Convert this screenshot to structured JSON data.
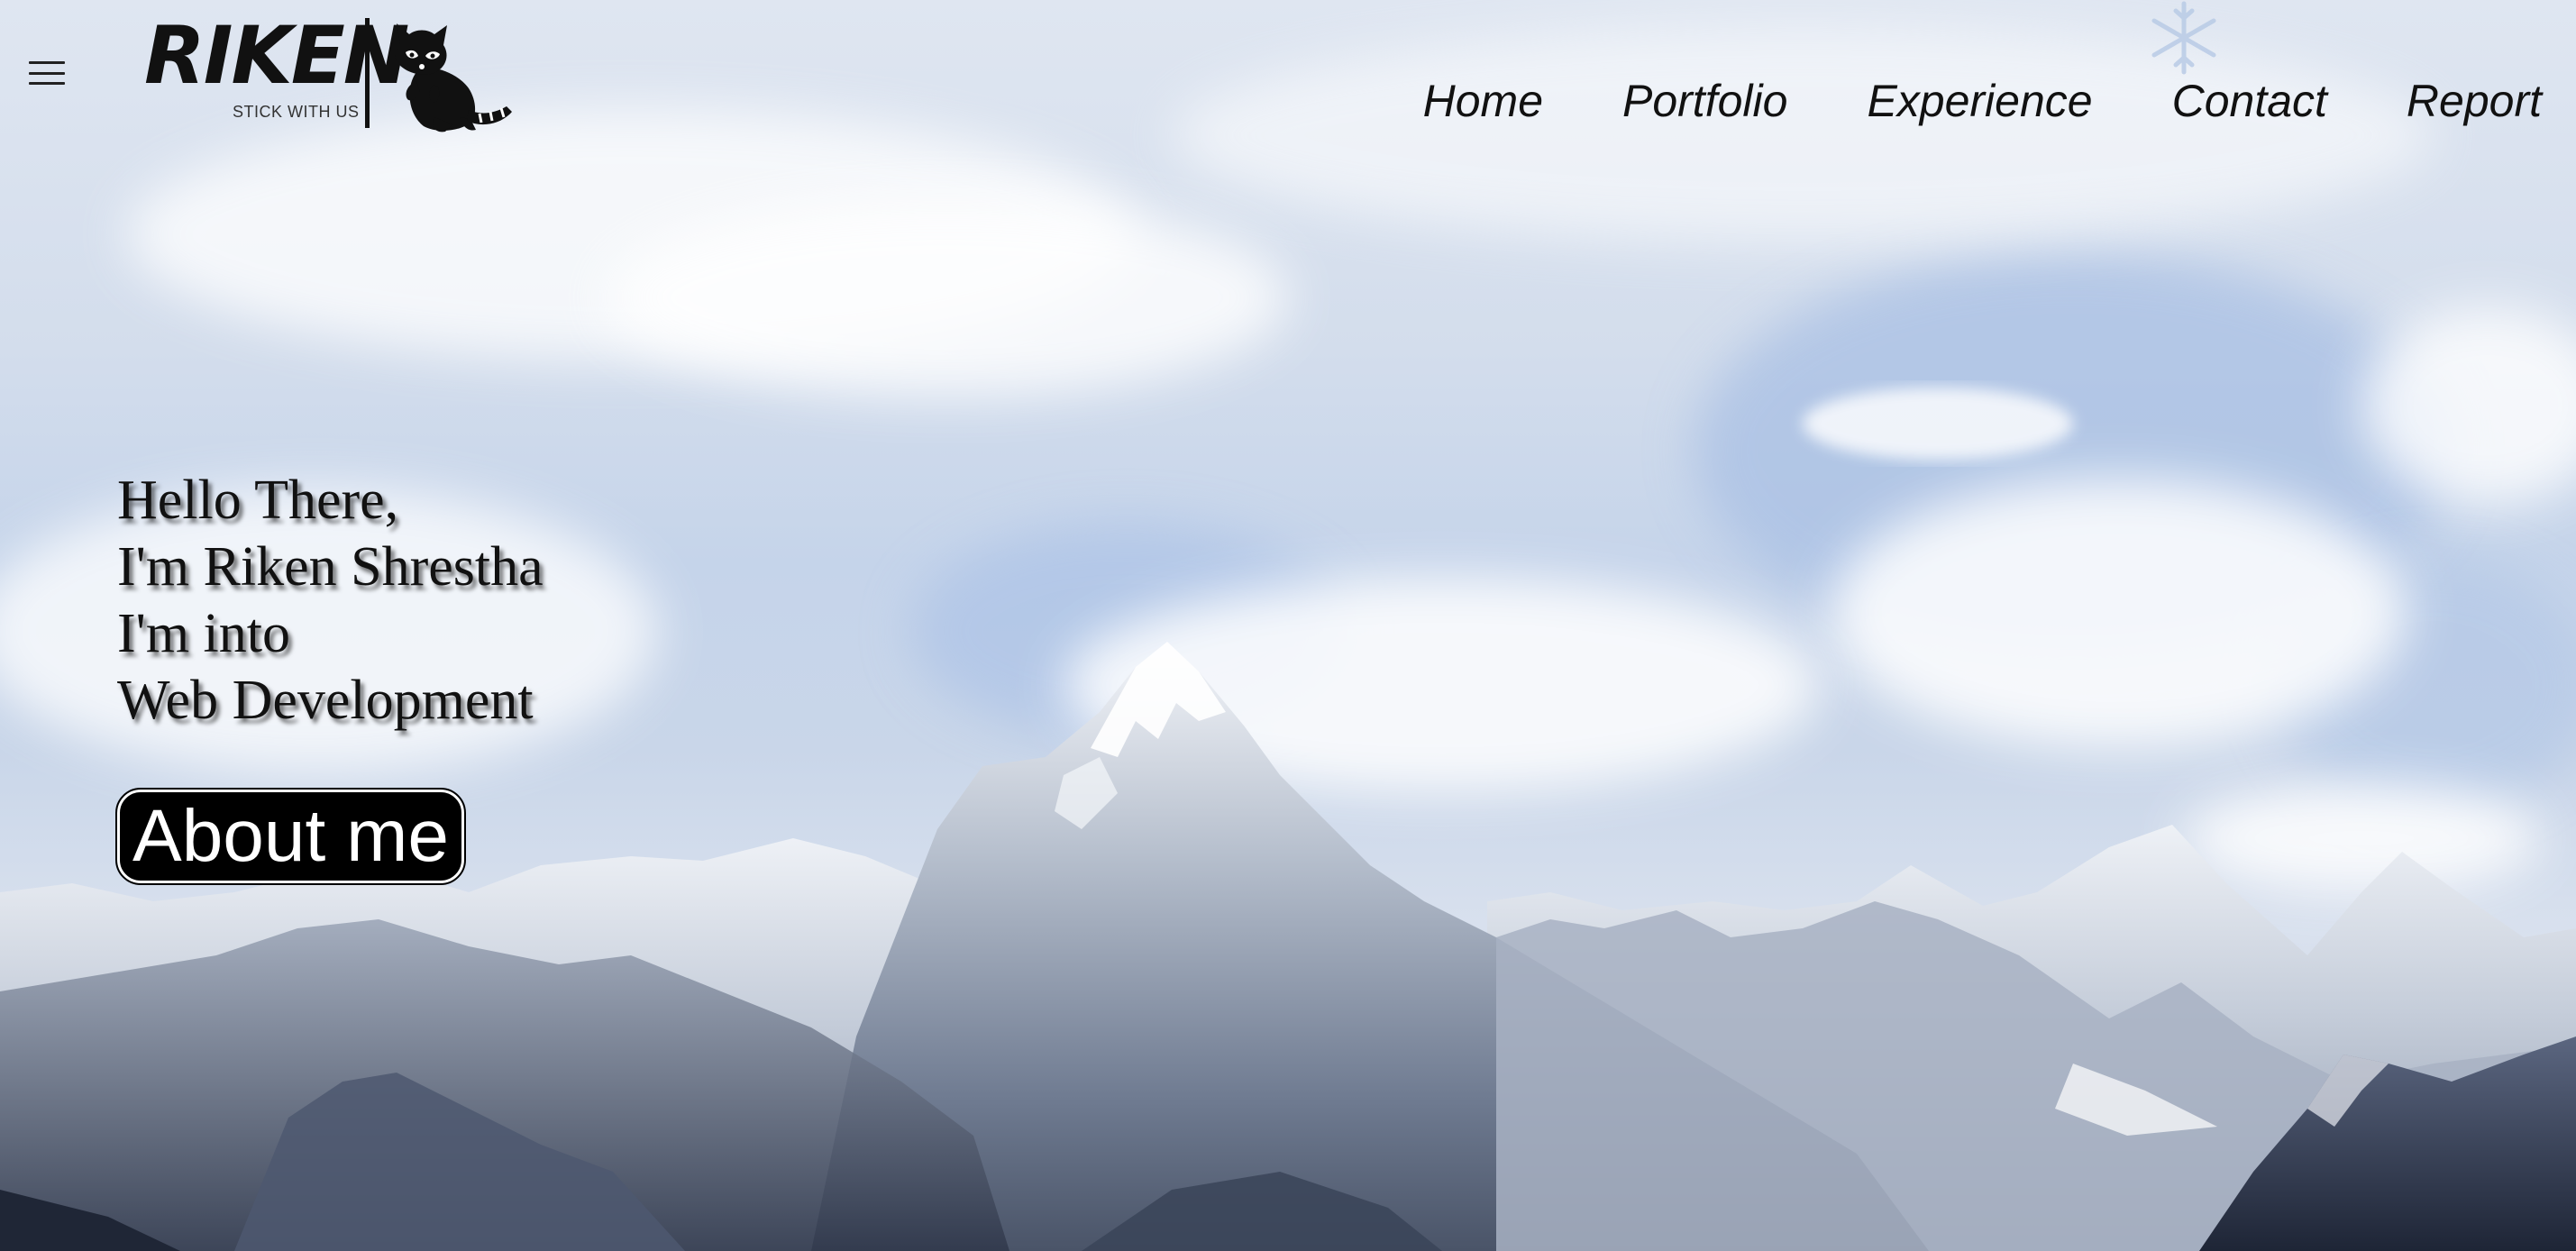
{
  "header": {
    "menu_icon": "hamburger-icon",
    "logo": {
      "word": "RIKEN",
      "tagline": "STICK WITH US",
      "mascot_icon": "raccoon-icon"
    },
    "nav": [
      {
        "label": "Home"
      },
      {
        "label": "Portfolio"
      },
      {
        "label": "Experience"
      },
      {
        "label": "Contact"
      },
      {
        "label": "Report"
      }
    ],
    "decoration_icon": "snowflake-icon"
  },
  "hero": {
    "lines": [
      "Hello There,",
      "I'm Riken Shrestha",
      "I'm into",
      "Web Development"
    ],
    "cta_label": "About me",
    "background": "snowy-mountain-range-photo"
  },
  "colors": {
    "text": "#111111",
    "button_bg": "#000000",
    "button_text": "#ffffff",
    "sky": "#c9d6e9"
  }
}
